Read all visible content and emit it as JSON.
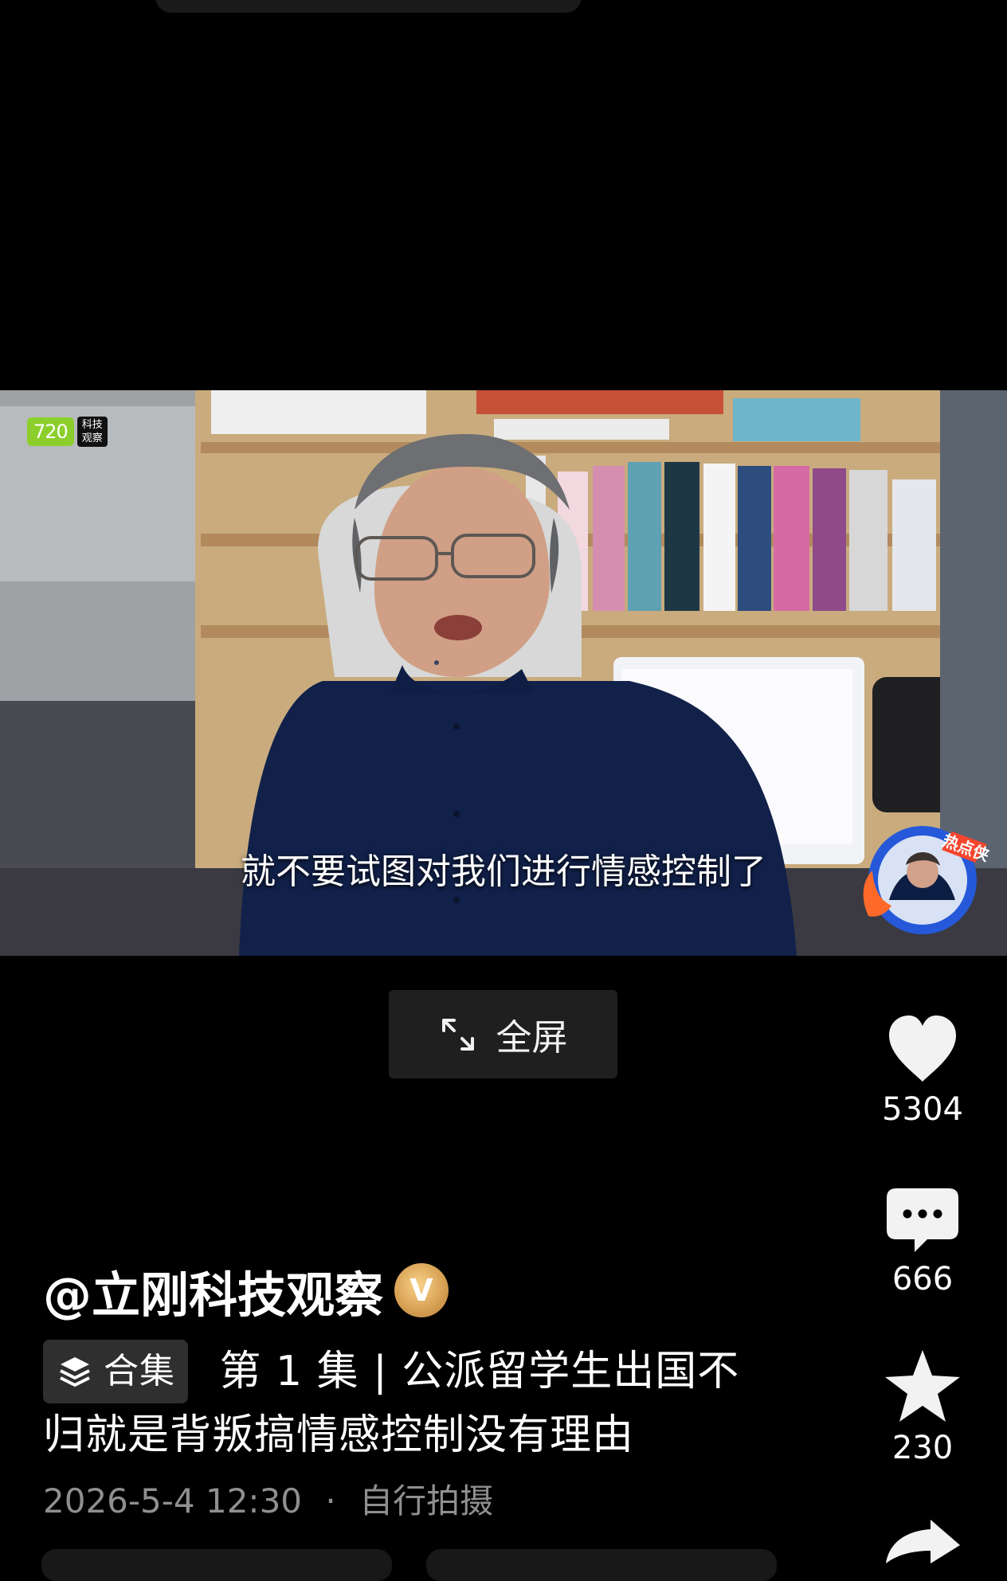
{
  "video": {
    "watermark_number": "720",
    "watermark_text": "科技观察",
    "subtitle": "就不要试图对我们进行情感控制了",
    "badge_text": "热点侠"
  },
  "player": {
    "fullscreen_label": "全屏"
  },
  "actions": {
    "likes": "5304",
    "comments": "666",
    "favorites": "230"
  },
  "post": {
    "author": "@立刚科技观察",
    "verified_label": "V",
    "collection_label": "合集",
    "title": "第 1 集 | 公派留学生出国不归就是背叛搞情感控制没有理由",
    "timestamp": "2026-5-4 12:30",
    "separator": "·",
    "source": "自行拍摄"
  },
  "icons": {
    "fullscreen": "fullscreen-icon",
    "like": "heart-icon",
    "comment": "comment-icon",
    "favorite": "star-icon",
    "share": "share-icon",
    "collection": "layers-icon"
  },
  "colors": {
    "background": "#000000",
    "watermark_green": "#8ccf2c",
    "verified_gold": "#d9a255",
    "meta_gray": "#8f8f8f"
  }
}
